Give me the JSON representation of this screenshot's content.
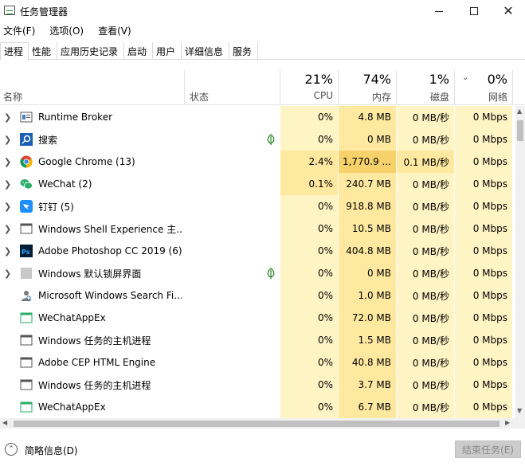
{
  "window": {
    "title": "任务管理器",
    "min_glyph": "—",
    "max_glyph": "☐",
    "close_glyph": "✕"
  },
  "menu": [
    "文件(F)",
    "选项(O)",
    "查看(V)"
  ],
  "tabs": [
    "进程",
    "性能",
    "应用历史记录",
    "启动",
    "用户",
    "详细信息",
    "服务"
  ],
  "active_tab": "进程",
  "columns": {
    "name": "名称",
    "status": "状态",
    "cpu": {
      "percent": "21%",
      "label": "CPU"
    },
    "memory": {
      "percent": "74%",
      "label": "内存"
    },
    "disk": {
      "percent": "1%",
      "label": "磁盘"
    },
    "network": {
      "percent": "0%",
      "label": "网络"
    },
    "sort_indicator": "chevron-down-icon"
  },
  "rows": [
    {
      "expandable": true,
      "icon": "runtime-broker-icon",
      "name": "Runtime Broker",
      "leaf": false,
      "cpu": "0%",
      "mem": "4.8 MB",
      "disk": "0 MB/秒",
      "net": "0 Mbps"
    },
    {
      "expandable": true,
      "icon": "search-icon",
      "name": "搜索",
      "leaf": true,
      "cpu": "0%",
      "mem": "0 MB",
      "disk": "0 MB/秒",
      "net": "0 Mbps"
    },
    {
      "expandable": true,
      "icon": "chrome-icon",
      "name": "Google Chrome (13)",
      "leaf": false,
      "cpu": "2.4%",
      "mem": "1,770.9 ...",
      "disk": "0.1 MB/秒",
      "net": "0 Mbps"
    },
    {
      "expandable": true,
      "icon": "wechat-icon",
      "name": "WeChat (2)",
      "leaf": false,
      "cpu": "0.1%",
      "mem": "240.7 MB",
      "disk": "0 MB/秒",
      "net": "0 Mbps"
    },
    {
      "expandable": true,
      "icon": "dingtalk-icon",
      "name": "钉钉 (5)",
      "leaf": false,
      "cpu": "0%",
      "mem": "918.8 MB",
      "disk": "0 MB/秒",
      "net": "0 Mbps"
    },
    {
      "expandable": true,
      "icon": "window-icon",
      "name": "Windows Shell Experience 主...",
      "leaf": false,
      "cpu": "0%",
      "mem": "10.5 MB",
      "disk": "0 MB/秒",
      "net": "0 Mbps"
    },
    {
      "expandable": true,
      "icon": "photoshop-icon",
      "name": "Adobe Photoshop CC 2019 (6)",
      "leaf": false,
      "cpu": "0%",
      "mem": "404.8 MB",
      "disk": "0 MB/秒",
      "net": "0 Mbps"
    },
    {
      "expandable": true,
      "icon": "gray-square-icon",
      "name": "Windows 默认锁屏界面",
      "leaf": true,
      "cpu": "0%",
      "mem": "0 MB",
      "disk": "0 MB/秒",
      "net": "0 Mbps"
    },
    {
      "expandable": false,
      "icon": "search-person-icon",
      "name": "Microsoft Windows Search Fi...",
      "leaf": false,
      "cpu": "0%",
      "mem": "1.0 MB",
      "disk": "0 MB/秒",
      "net": "0 Mbps"
    },
    {
      "expandable": false,
      "icon": "wechat-app-icon",
      "name": "WeChatAppEx",
      "leaf": false,
      "cpu": "0%",
      "mem": "72.0 MB",
      "disk": "0 MB/秒",
      "net": "0 Mbps"
    },
    {
      "expandable": false,
      "icon": "window-icon",
      "name": "Windows 任务的主机进程",
      "leaf": false,
      "cpu": "0%",
      "mem": "1.5 MB",
      "disk": "0 MB/秒",
      "net": "0 Mbps"
    },
    {
      "expandable": false,
      "icon": "window-icon",
      "name": "Adobe CEP HTML Engine",
      "leaf": false,
      "cpu": "0%",
      "mem": "40.8 MB",
      "disk": "0 MB/秒",
      "net": "0 Mbps"
    },
    {
      "expandable": false,
      "icon": "window-icon",
      "name": "Windows 任务的主机进程",
      "leaf": false,
      "cpu": "0%",
      "mem": "3.7 MB",
      "disk": "0 MB/秒",
      "net": "0 Mbps"
    },
    {
      "expandable": false,
      "icon": "wechat-app-icon",
      "name": "WeChatAppEx",
      "leaf": false,
      "cpu": "0%",
      "mem": "6.7 MB",
      "disk": "0 MB/秒",
      "net": "0 Mbps"
    }
  ],
  "heat_colors": {
    "light": "#fff4c4",
    "medium": "#ffe9a0",
    "strong": "#f9e08a",
    "chrome_mem": "#f7d26b"
  },
  "footer": {
    "fewer_details": "简略信息(D)",
    "end_task": "结束任务(E)"
  }
}
